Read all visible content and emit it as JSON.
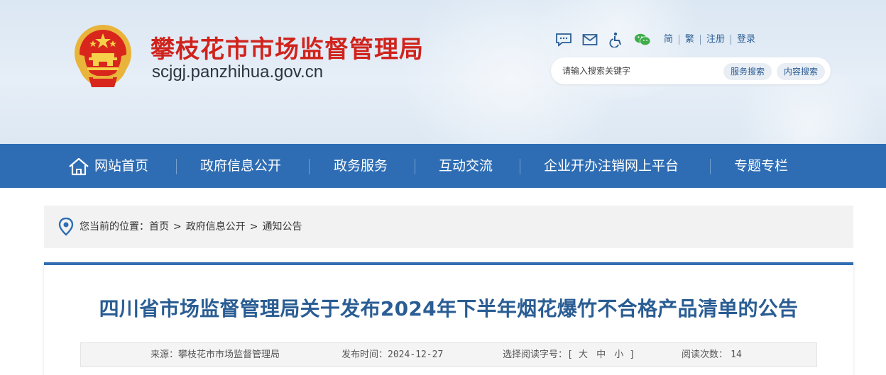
{
  "header": {
    "site_title": "攀枝花市市场监督管理局",
    "site_domain": "scjgj.panzhihua.gov.cn",
    "toolbar": {
      "icons": [
        "message-icon",
        "mail-icon",
        "accessibility-icon",
        "wechat-icon"
      ],
      "links": [
        "简",
        "繁",
        "注册",
        "登录"
      ]
    },
    "search": {
      "placeholder": "请输入搜索关键字",
      "service_search": "服务搜索",
      "content_search": "内容搜索"
    }
  },
  "nav": {
    "items": [
      "网站首页",
      "政府信息公开",
      "政务服务",
      "互动交流",
      "企业开办注销网上平台",
      "专题专栏"
    ]
  },
  "breadcrumb": {
    "prefix": "您当前的位置：",
    "items": [
      "首页",
      "政府信息公开",
      "通知公告"
    ],
    "separator": ">"
  },
  "article": {
    "title": "四川省市场监督管理局关于发布2024年下半年烟花爆竹不合格产品清单的公告",
    "meta": {
      "source_label": "来源：",
      "source": "攀枝花市市场监督管理局",
      "date_label": "发布时间：",
      "date": "2024-12-27",
      "font_size_label": "选择阅读字号：",
      "bracket_open": "[",
      "sizes": [
        "大",
        "中",
        "小"
      ],
      "bracket_close": "]",
      "views_label": "阅读次数：",
      "views": "14"
    }
  },
  "colors": {
    "brand_red": "#d0231c",
    "nav_blue": "#2e6db4",
    "link_blue": "#2a5d93",
    "header_bg": "#dbe7f3"
  }
}
